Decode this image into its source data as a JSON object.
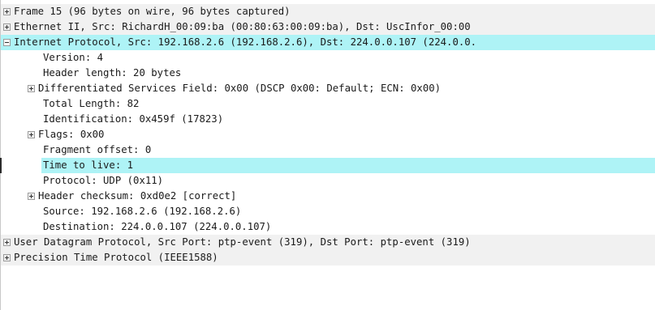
{
  "tree": {
    "rows": [
      {
        "text": "Frame 15 (96 bytes on wire, 96 bytes captured)",
        "expander": "plus"
      },
      {
        "text": "Ethernet II, Src: RichardH_00:09:ba (00:80:63:00:09:ba), Dst: UscInfor_00:00",
        "expander": "plus"
      },
      {
        "text": "Internet Protocol, Src: 192.168.2.6 (192.168.2.6), Dst: 224.0.0.107 (224.0.0.",
        "expander": "minus"
      },
      {
        "text": "Version: 4"
      },
      {
        "text": "Header length: 20 bytes"
      },
      {
        "text": "Differentiated Services Field: 0x00 (DSCP 0x00: Default; ECN: 0x00)",
        "expander": "plus"
      },
      {
        "text": "Total Length: 82"
      },
      {
        "text": "Identification: 0x459f (17823)"
      },
      {
        "text": "Flags: 0x00",
        "expander": "plus"
      },
      {
        "text": "Fragment offset: 0"
      },
      {
        "text": "Time to live: 1"
      },
      {
        "text": "Protocol: UDP (0x11)"
      },
      {
        "text": "Header checksum: 0xd0e2 [correct]",
        "expander": "plus"
      },
      {
        "text": "Source: 192.168.2.6 (192.168.2.6)"
      },
      {
        "text": "Destination: 224.0.0.107 (224.0.0.107)"
      },
      {
        "text": "User Datagram Protocol, Src Port: ptp-event (319), Dst Port: ptp-event (319)",
        "expander": "plus"
      },
      {
        "text": "Precision Time Protocol (IEEE1588)",
        "expander": "plus"
      }
    ]
  },
  "colors": {
    "selection": "#aef3f6",
    "summary_row": "#f1f1f1"
  }
}
